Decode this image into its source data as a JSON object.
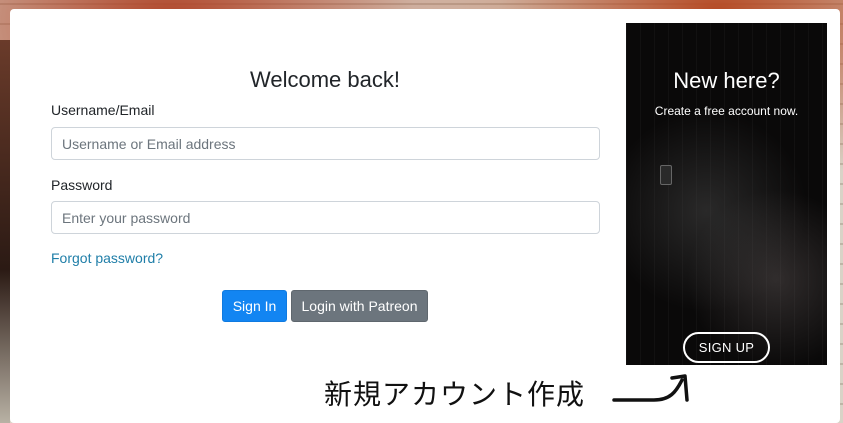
{
  "login": {
    "title": "Welcome back!",
    "username_label": "Username/Email",
    "username_placeholder": "Username or Email address",
    "password_label": "Password",
    "password_placeholder": "Enter your password",
    "forgot_link": "Forgot password?",
    "sign_in_label": "Sign In",
    "patreon_label": "Login with Patreon"
  },
  "promo": {
    "title": "New here?",
    "subtitle": "Create a free account now.",
    "signup_label": "SIGN UP"
  },
  "annotation": {
    "text": "新規アカウント作成",
    "arrow_icon": "curved-arrow-icon"
  },
  "colors": {
    "primary": "#1285f2",
    "secondary": "#6c757d",
    "link": "#1f7ea8",
    "promo_bg": "#0a0909"
  }
}
